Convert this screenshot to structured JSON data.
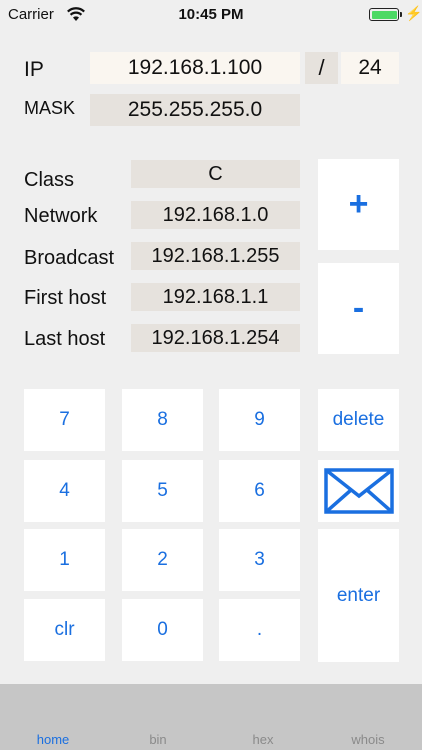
{
  "status": {
    "carrier": "Carrier",
    "time": "10:45 PM",
    "battery_level": 1.0
  },
  "ip": {
    "label": "IP",
    "value": "192.168.1.100",
    "slash": "/",
    "prefix": "24"
  },
  "mask": {
    "label": "MASK",
    "value": "255.255.255.0"
  },
  "info": [
    {
      "label": "Class",
      "value": "C"
    },
    {
      "label": "Network",
      "value": "192.168.1.0"
    },
    {
      "label": "Broadcast",
      "value": "192.168.1.255"
    },
    {
      "label": "First host",
      "value": "192.168.1.1"
    },
    {
      "label": "Last host",
      "value": "192.168.1.254"
    }
  ],
  "controls": {
    "plus": "+",
    "minus": "-"
  },
  "keypad": {
    "k7": "7",
    "k8": "8",
    "k9": "9",
    "delete": "delete",
    "k4": "4",
    "k5": "5",
    "k6": "6",
    "k1": "1",
    "k2": "2",
    "k3": "3",
    "enter": "enter",
    "clr": "clr",
    "k0": "0",
    "dot": ".",
    "mail_icon": "envelope-icon"
  },
  "tabs": [
    {
      "label": "home",
      "active": true
    },
    {
      "label": "bin",
      "active": false
    },
    {
      "label": "hex",
      "active": false
    },
    {
      "label": "whois",
      "active": false
    }
  ],
  "colors": {
    "accent": "#1a6fe0",
    "field": "#e6e2dd",
    "battery": "#4cd964"
  }
}
